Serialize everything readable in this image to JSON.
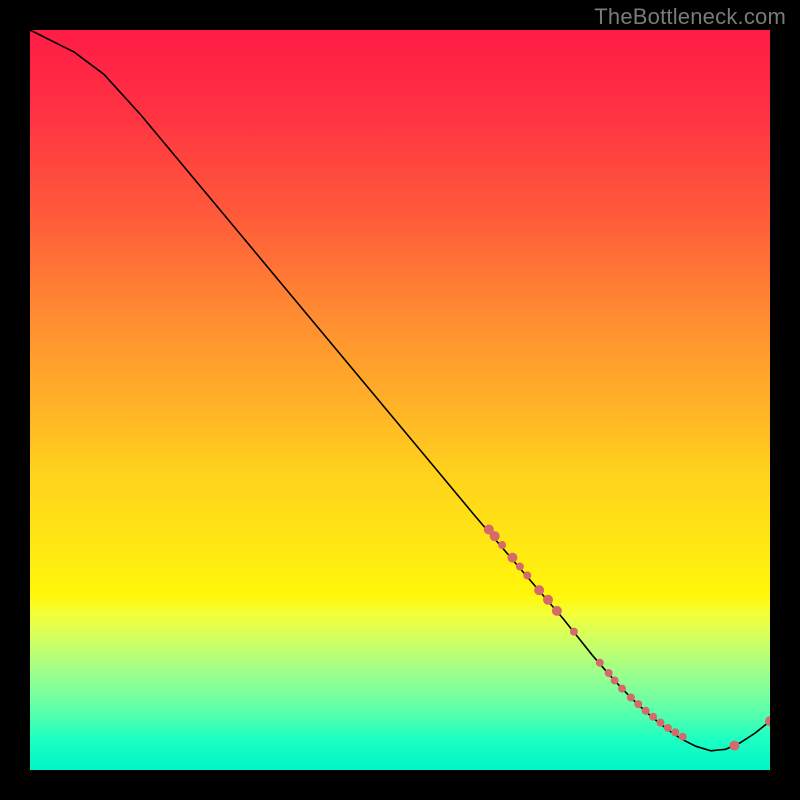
{
  "watermark": "TheBottleneck.com",
  "colors": {
    "background": "#000000",
    "curve": "#000000",
    "marker": "#d66a6a",
    "watermark_text": "#7a7a7a",
    "gradient_top": "#ff1c46",
    "gradient_bottom": "#00f5c8"
  },
  "chart_data": {
    "type": "line",
    "title": "",
    "xlabel": "",
    "ylabel": "",
    "xlim": [
      0,
      100
    ],
    "ylim": [
      0,
      100
    ],
    "grid": false,
    "legend": false,
    "series": [
      {
        "name": "bottleneck-curve",
        "x": [
          0,
          2,
          4,
          6,
          8,
          10,
          15,
          20,
          25,
          30,
          35,
          40,
          45,
          50,
          55,
          60,
          63,
          66,
          69,
          72,
          74,
          76,
          78,
          80,
          82,
          84,
          86,
          88,
          90,
          92,
          94,
          96,
          98,
          100
        ],
        "y": [
          100,
          99,
          98,
          97,
          95.5,
          94,
          88.5,
          82.5,
          76.5,
          70.5,
          64.5,
          58.5,
          52.5,
          46.5,
          40.5,
          34.5,
          31,
          27.5,
          24,
          20.5,
          18,
          15.5,
          13.2,
          11,
          9,
          7.2,
          5.6,
          4.2,
          3.2,
          2.6,
          2.8,
          3.7,
          5,
          6.6
        ]
      }
    ],
    "markers": [
      {
        "x": 62.0,
        "y": 32.5,
        "r": 5
      },
      {
        "x": 62.8,
        "y": 31.6,
        "r": 5
      },
      {
        "x": 63.8,
        "y": 30.4,
        "r": 4
      },
      {
        "x": 65.2,
        "y": 28.7,
        "r": 5
      },
      {
        "x": 66.2,
        "y": 27.5,
        "r": 4
      },
      {
        "x": 67.2,
        "y": 26.3,
        "r": 4
      },
      {
        "x": 68.8,
        "y": 24.3,
        "r": 5
      },
      {
        "x": 70.0,
        "y": 23.0,
        "r": 5
      },
      {
        "x": 71.2,
        "y": 21.5,
        "r": 5
      },
      {
        "x": 73.5,
        "y": 18.7,
        "r": 4
      },
      {
        "x": 77.0,
        "y": 14.5,
        "r": 4
      },
      {
        "x": 78.2,
        "y": 13.1,
        "r": 4
      },
      {
        "x": 79.0,
        "y": 12.1,
        "r": 4
      },
      {
        "x": 80.0,
        "y": 11.0,
        "r": 4
      },
      {
        "x": 81.2,
        "y": 9.8,
        "r": 4
      },
      {
        "x": 82.2,
        "y": 8.9,
        "r": 4
      },
      {
        "x": 83.2,
        "y": 8.0,
        "r": 4
      },
      {
        "x": 84.2,
        "y": 7.2,
        "r": 4
      },
      {
        "x": 85.2,
        "y": 6.4,
        "r": 4
      },
      {
        "x": 86.2,
        "y": 5.7,
        "r": 4
      },
      {
        "x": 87.2,
        "y": 5.1,
        "r": 4
      },
      {
        "x": 88.2,
        "y": 4.5,
        "r": 4
      },
      {
        "x": 95.2,
        "y": 3.3,
        "r": 5
      },
      {
        "x": 100.0,
        "y": 6.6,
        "r": 5
      }
    ]
  }
}
